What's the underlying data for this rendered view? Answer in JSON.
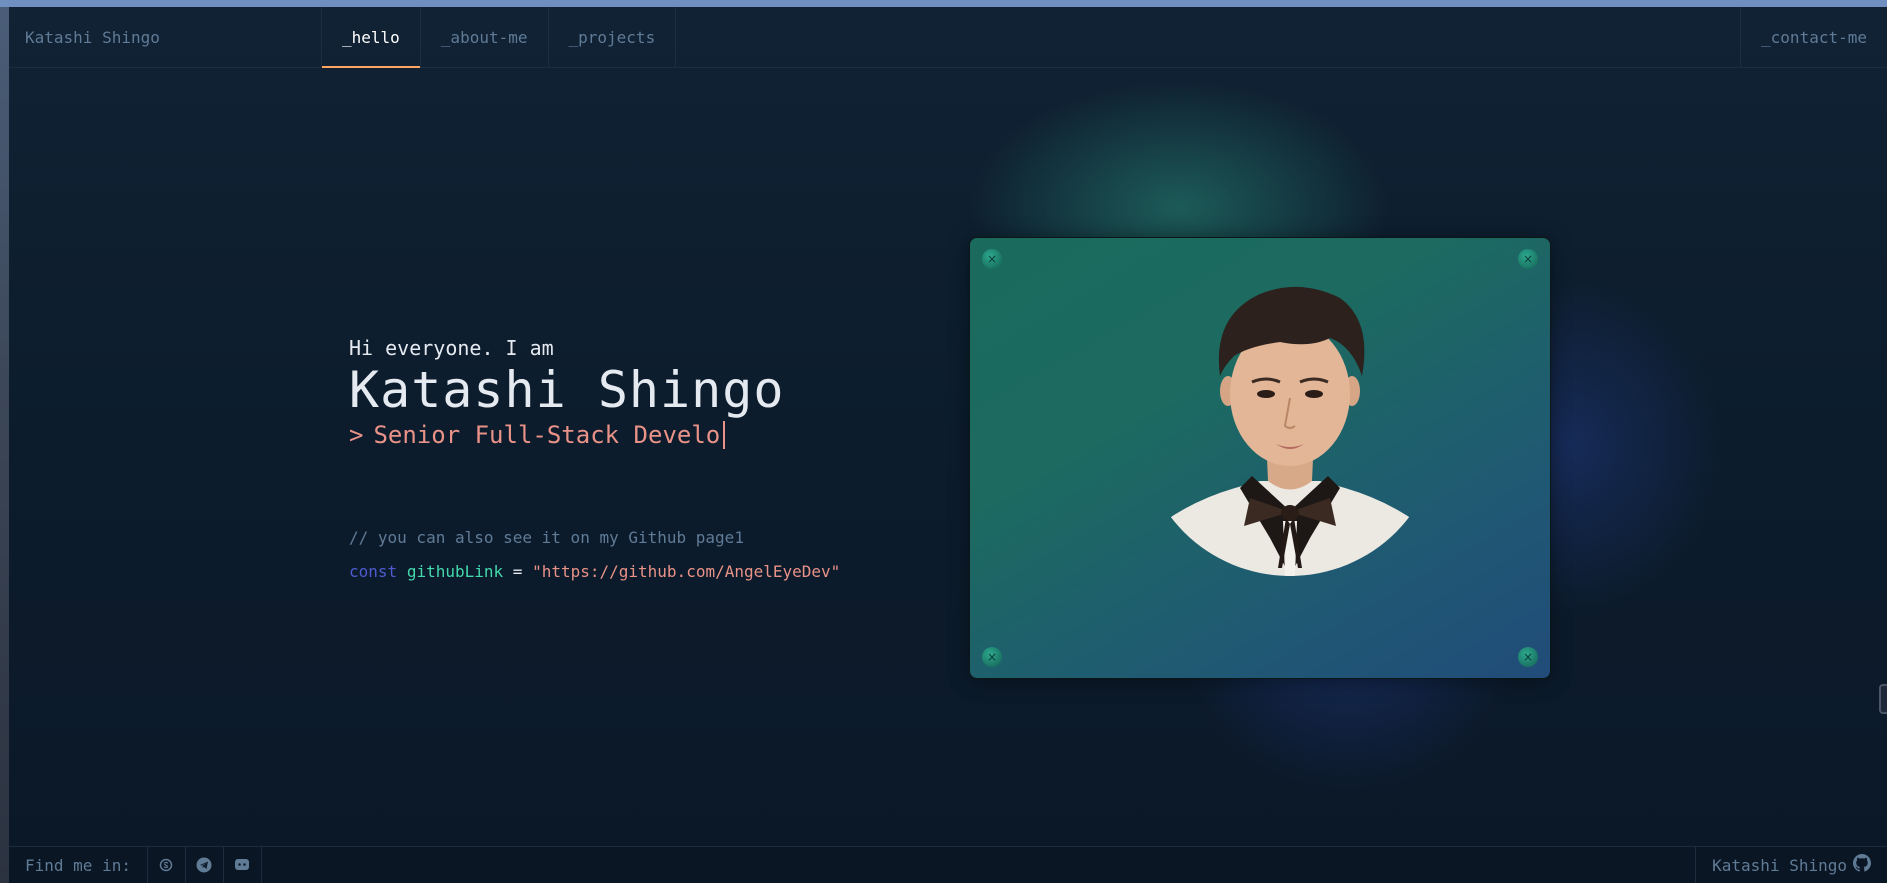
{
  "nav": {
    "brand": "Katashi Shingo",
    "tabs": [
      {
        "label": "_hello",
        "active": true
      },
      {
        "label": "_about-me",
        "active": false
      },
      {
        "label": "_projects",
        "active": false
      }
    ],
    "contact": "_contact-me"
  },
  "hero": {
    "greeting": "Hi everyone. I am",
    "name": "Katashi Shingo",
    "role_prefix": ">",
    "role": "Senior Full-Stack Develo"
  },
  "code": {
    "comment": "// you can also see it on my Github page1",
    "keyword": "const",
    "variable": "githubLink",
    "operator": "=",
    "value": "\"https://github.com/AngelEyeDev\""
  },
  "photo_card": {
    "bolt_glyph": "×"
  },
  "footer": {
    "find_me": "Find me in:",
    "socials": [
      "skype-icon",
      "telegram-icon",
      "discord-icon"
    ],
    "right_label": "Katashi Shingo"
  },
  "colors": {
    "accent": "#fea55f",
    "keyword": "#4d5bce",
    "variable": "#43d9ad",
    "string": "#e99287",
    "muted": "#607b96"
  }
}
